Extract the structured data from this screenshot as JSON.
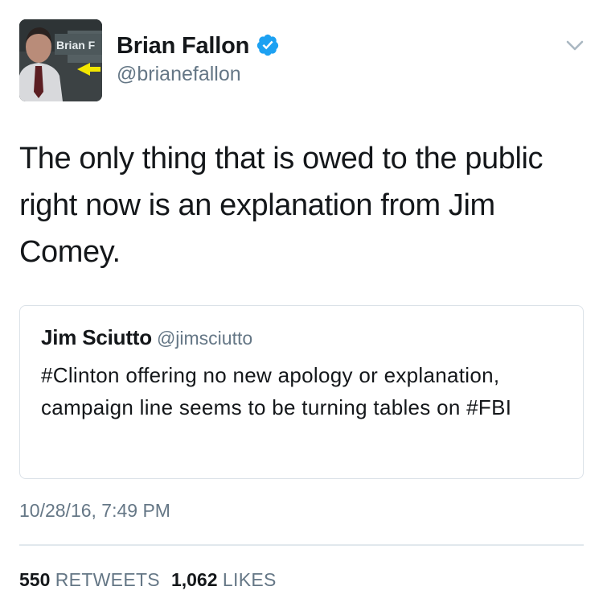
{
  "author": {
    "display_name": "Brian Fallon",
    "handle": "@brianefallon",
    "verified": true,
    "avatar_caption": "Brian F"
  },
  "tweet": {
    "text": "The only thing that is owed to the public right now is an explanation from Jim Comey.",
    "timestamp": "10/28/16, 7:49 PM"
  },
  "quoted_tweet": {
    "display_name": "Jim Sciutto",
    "handle": "@jimsciutto",
    "text": "#Clinton offering no new apology or explanation, campaign line seems to be turning tables on #FBI"
  },
  "stats": {
    "retweets_count": "550",
    "retweets_label": "RETWEETS",
    "likes_count": "1,062",
    "likes_label": "LIKES"
  },
  "colors": {
    "text_primary": "#14171a",
    "text_secondary": "#657786",
    "verified_blue": "#1da1f2",
    "border": "#dbe2e8",
    "caret": "#aab8c2"
  },
  "icons": {
    "verified": "verified-badge-icon",
    "menu": "chevron-down-icon"
  }
}
